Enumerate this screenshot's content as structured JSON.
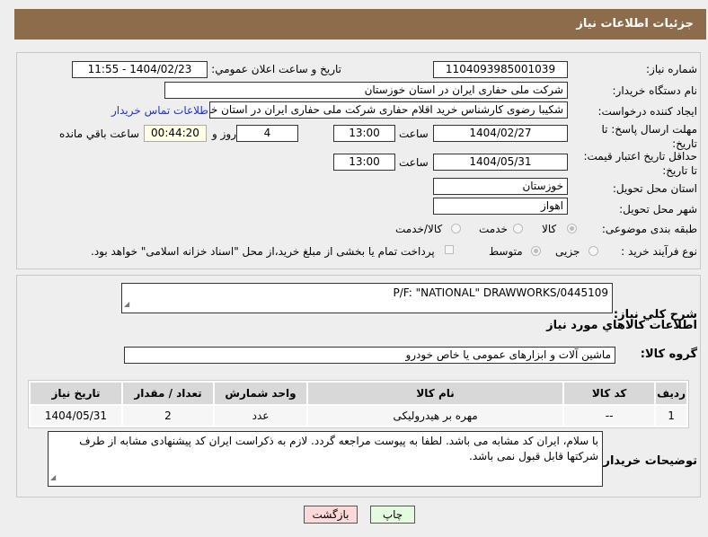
{
  "header": {
    "title": "جزئیات اطلاعات نیاز"
  },
  "form": {
    "need_number": {
      "label": "شماره نیاز:",
      "value": "1104093985001039"
    },
    "announce": {
      "label": "تاریخ و ساعت اعلان عمومي:",
      "value": "1404/02/23 - 11:55"
    },
    "buyer_org": {
      "label": "نام دستگاه خریدار:",
      "value": "شرکت ملی حفاری ایران در استان خوزستان"
    },
    "creator": {
      "label": "ایجاد کننده درخواست:",
      "value": "شکیبا رضوی کارشناس خرید اقلام حفاری شرکت ملی حفاری ایران در استان خوزستان",
      "link": "اطلاعات تماس خریدار"
    },
    "deadline": {
      "label": "مهلت ارسال پاسخ: تا تاریخ:",
      "date": "1404/02/27",
      "time_label": "ساعت",
      "time": "13:00",
      "days": "4",
      "days_label": "روز و",
      "remaining": "00:44:20",
      "remaining_label": "ساعت باقي مانده"
    },
    "validity": {
      "label": "حداقل تاریخ اعتبار قیمت: تا تاریخ:",
      "date": "1404/05/31",
      "time_label": "ساعت",
      "time": "13:00"
    },
    "province": {
      "label": "استان محل تحویل:",
      "value": "خوزستان"
    },
    "city": {
      "label": "شهر محل تحویل:",
      "value": "اهواز"
    },
    "category": {
      "label": "طبقه بندی موضوعی:",
      "options": [
        "کالا",
        "خدمت",
        "کالا/خدمت"
      ],
      "selected": "کالا"
    },
    "process": {
      "label": "نوع فرآیند خرید :",
      "options": [
        "جزیی",
        "متوسط"
      ],
      "selected": "متوسط",
      "note": "پرداخت تمام یا بخشی از مبلغ خرید،از محل \"اسناد خزانه اسلامی\" خواهد بود."
    }
  },
  "details": {
    "description_label": "شرح كلي نياز:",
    "description": "P/F: \"NATIONAL\" DRAWWORKS/0445109",
    "goods_title": "اطلاعات كالاهاي مورد نياز",
    "group_label": "گروه کالا:",
    "group": "ماشین آلات و ابزارهای عمومی یا خاص خودرو",
    "table": {
      "headers": [
        "ردیف",
        "کد کالا",
        "نام کالا",
        "واحد شمارش",
        "تعداد / مقدار",
        "تاریخ نیاز"
      ],
      "rows": [
        [
          "1",
          "--",
          "مهره بر هیدرولیکی",
          "عدد",
          "2",
          "1404/05/31"
        ]
      ]
    },
    "notes_label": "توضیحات خریدار:",
    "notes": "با سلام، ایران کد مشابه می باشد. لطفا به پیوست مراجعه گردد. لازم به ذکراست ایران کد پیشنهادی مشابه از طرف شرکتها قابل قبول نمی باشد."
  },
  "buttons": {
    "print": "چاپ",
    "back": "بازگشت"
  }
}
